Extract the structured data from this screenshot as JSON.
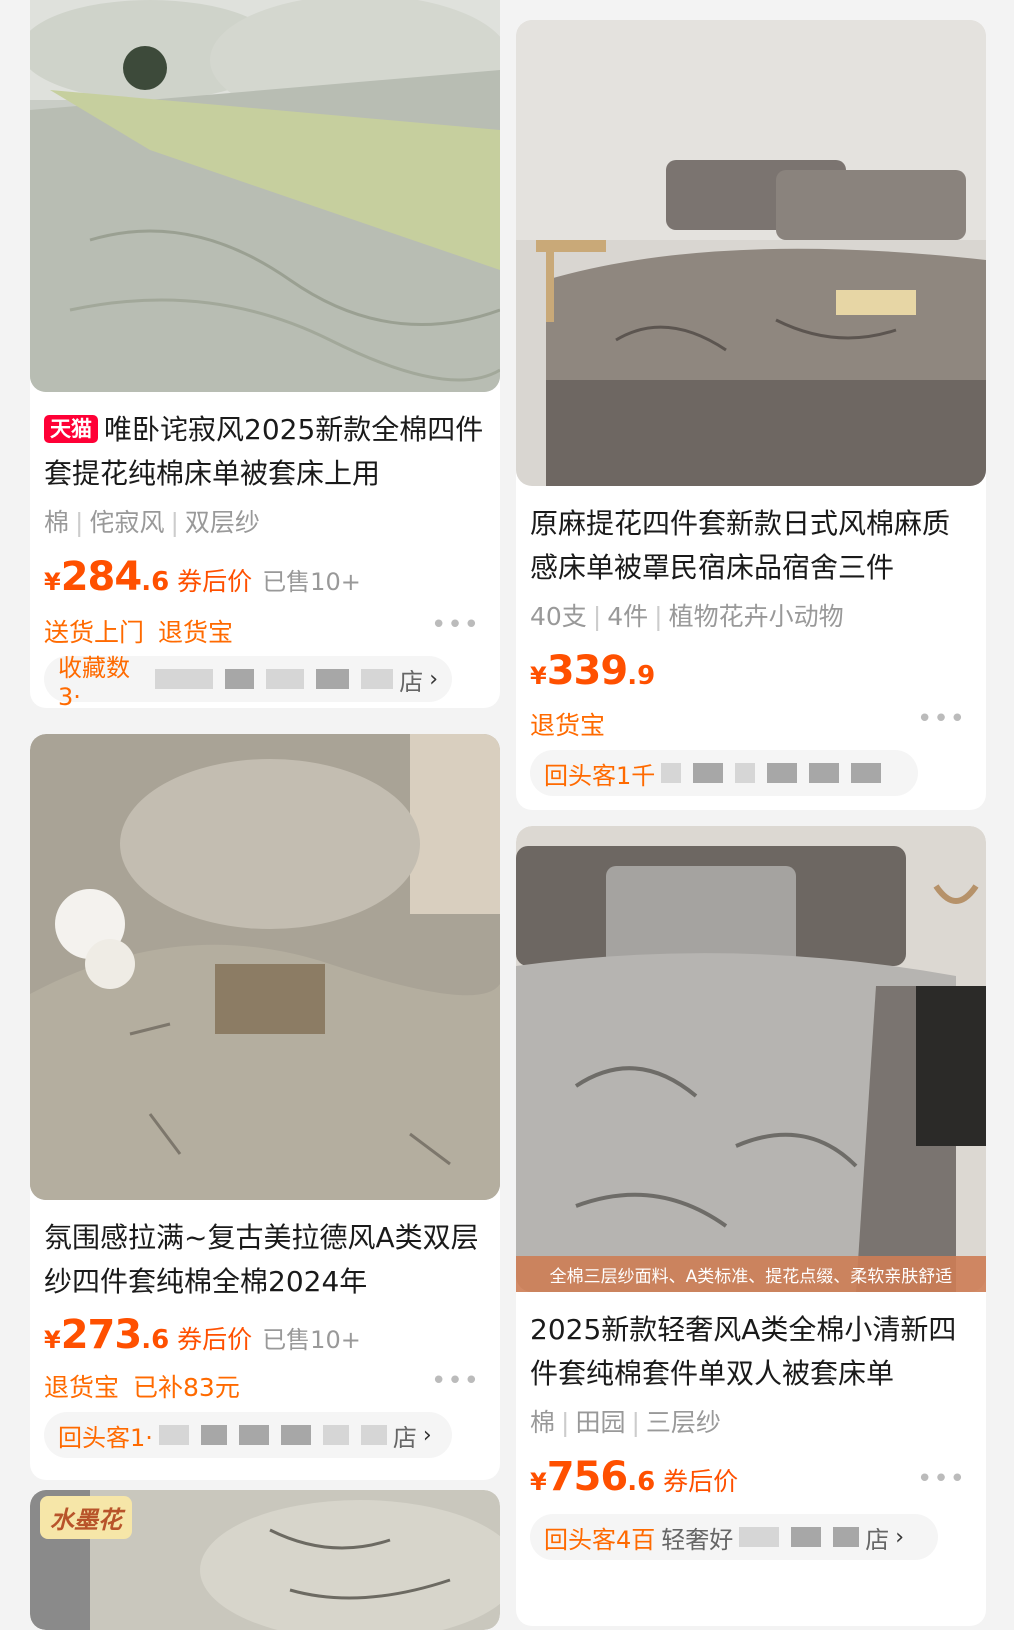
{
  "products": [
    {
      "badge": "天猫",
      "title": "唯卧诧寂风2025新款全棉四件套提花纯棉床单被套床上用",
      "tags": [
        "棉",
        "侘寂风",
        "双层纱"
      ],
      "price_currency": "¥",
      "price_int": "284",
      "price_dec": ".6",
      "coupon": "券后价",
      "sold": "已售10+",
      "services": [
        "送货上门",
        "退货宝"
      ],
      "store_prefix": "收藏数3·",
      "store_suffix": "店",
      "chevron": "›"
    },
    {
      "title": "原麻提花四件套新款日式风棉麻质感床单被罩民宿床品宿舍三件",
      "tags": [
        "40支",
        "4件",
        "植物花卉小动物"
      ],
      "price_currency": "¥",
      "price_int": "339",
      "price_dec": ".9",
      "services": [
        "退货宝"
      ],
      "store_prefix": "回头客1千"
    },
    {
      "title": "氛围感拉满~复古美拉德风A类双层纱四件套纯棉全棉2024年",
      "price_currency": "¥",
      "price_int": "273",
      "price_dec": ".6",
      "coupon": "券后价",
      "sold": "已售10+",
      "services": [
        "退货宝",
        "已补83元"
      ],
      "store_prefix": "回头客1·",
      "store_suffix": "店",
      "chevron": "›"
    },
    {
      "banner": "全棉三层纱面料、A类标准、提花点缀、柔软亲肤舒适",
      "title": "2025新款轻奢风A类全棉小清新四件套纯棉套件单双人被套床单",
      "tags": [
        "棉",
        "田园",
        "三层纱"
      ],
      "price_currency": "¥",
      "price_int": "756",
      "price_dec": ".6",
      "coupon": "券后价",
      "store_prefix": "回头客4百",
      "store_name": "轻奢好",
      "store_suffix": "店",
      "chevron": "›"
    },
    {
      "ink_tag": "水墨花"
    }
  ],
  "more_icon": "•••",
  "colors": {
    "accent": "#ff5000",
    "service": "#ff6a00",
    "tmall": "#ff0036"
  }
}
